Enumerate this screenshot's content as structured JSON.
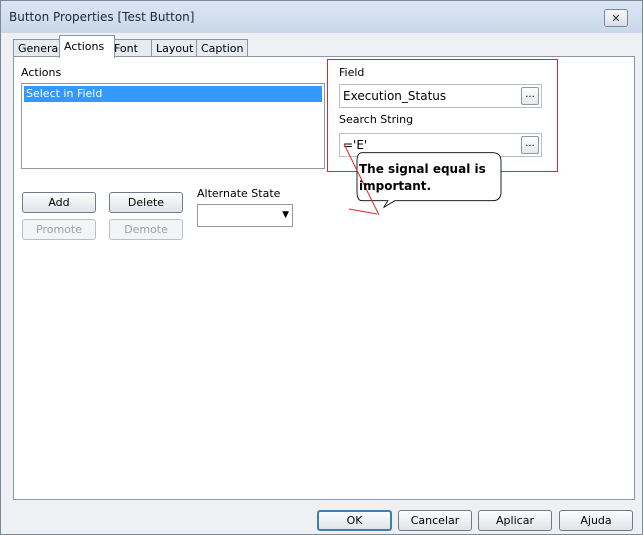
{
  "window": {
    "title": "Button Properties [Test Button]",
    "close_label": "✕"
  },
  "tabs": [
    {
      "label": "General"
    },
    {
      "label": "Actions"
    },
    {
      "label": "Font"
    },
    {
      "label": "Layout"
    },
    {
      "label": "Caption"
    }
  ],
  "actions": {
    "label": "Actions",
    "items": [
      "Select in Field"
    ],
    "add_label": "Add",
    "delete_label": "Delete",
    "promote_label": "Promote",
    "demote_label": "Demote"
  },
  "alternate_state": {
    "label": "Alternate State",
    "value": ""
  },
  "field": {
    "label": "Field",
    "value": "Execution_Status",
    "button_label": "..."
  },
  "search_string": {
    "label": "Search String",
    "value": "='E'",
    "button_label": "..."
  },
  "annotation": {
    "text": "The signal equal is important."
  },
  "footer": {
    "ok_label": "OK",
    "cancel_label": "Cancelar",
    "apply_label": "Aplicar",
    "help_label": "Ajuda"
  },
  "colors": {
    "highlight_border": "#d82b2b",
    "selection": "#3399ff"
  }
}
